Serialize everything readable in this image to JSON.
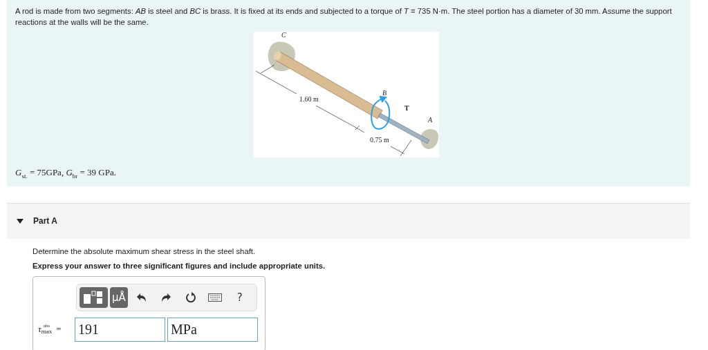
{
  "problem": {
    "statement": "A rod is made from two segments: *AB* is steel and *BC* is brass. It is fixed at its ends and subjected to a torque of *T* = 735 N·m. The steel portion has a diameter of 30 mm. Assume the support reactions at the walls will be the same.",
    "figure": {
      "labels": [
        {
          "kind": "point",
          "text": "C"
        },
        {
          "kind": "point",
          "text": "B"
        },
        {
          "kind": "torque",
          "text": "T"
        },
        {
          "kind": "point",
          "text": "A"
        },
        {
          "kind": "length",
          "text": "1.60 m"
        },
        {
          "kind": "length",
          "text": "0.75 m"
        }
      ]
    },
    "moduli": "*G*$_{st.}$ = 75GPa, *G*$_{br}$ = 39 GPa."
  },
  "part": {
    "title": "Part A",
    "expanded": true,
    "question": "Determine the absolute maximum shear stress in the steel shaft.",
    "instruction": "Express your answer to three significant figures and include appropriate units.",
    "toolbar": [
      {
        "kind": "templates"
      },
      {
        "kind": "units",
        "text": "μÅ"
      },
      {
        "kind": "undo"
      },
      {
        "kind": "redo"
      },
      {
        "kind": "reset"
      },
      {
        "kind": "keyboard"
      },
      {
        "kind": "help",
        "text": "?"
      }
    ],
    "answer": {
      "symbol": "τ",
      "sup": "abs",
      "sub": "max",
      "equals": "=",
      "value": "191",
      "units": "MPa"
    }
  }
}
